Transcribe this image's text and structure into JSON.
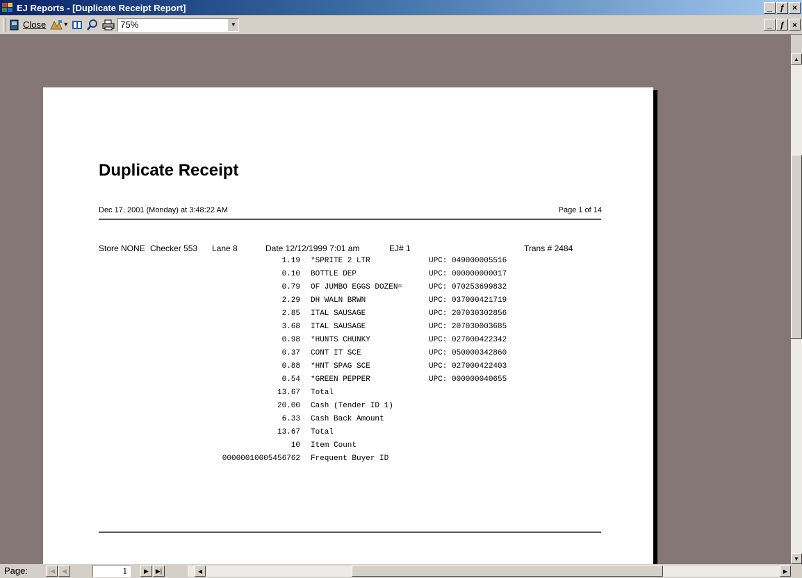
{
  "window": {
    "title": "EJ Reports - [Duplicate Receipt Report]",
    "minimize": "_",
    "restore": "ƒ",
    "close": "×"
  },
  "toolbar": {
    "close_label": "Close",
    "zoom_value": "75%",
    "icons": [
      "report-icon",
      "view-icon",
      "two-pages-icon",
      "zoom-icon",
      "print-icon"
    ]
  },
  "report": {
    "title": "Duplicate Receipt",
    "run_date": "Dec 17, 2001 (Monday) at 3:48:22 AM",
    "page_info": "Page 1 of 14",
    "store": "Store NONE",
    "checker": "Checker 553",
    "lane": "Lane  8",
    "date": "Date  12/12/1999 7:01 am",
    "ej": "EJ#  1",
    "trans": "Trans # 2484",
    "lines": [
      {
        "amount": "1.19",
        "desc": "*SPRITE 2 LTR",
        "upc": "UPC: 049000005516"
      },
      {
        "amount": "0.10",
        "desc": "BOTTLE DEP",
        "upc": "UPC: 000000000017"
      },
      {
        "amount": "0.79",
        "desc": "OF JUMBO EGGS DOZEN=",
        "upc": "UPC: 070253699832"
      },
      {
        "amount": "2.29",
        "desc": "DH WALN BRWN",
        "upc": "UPC: 037000421719"
      },
      {
        "amount": "2.85",
        "desc": "ITAL SAUSAGE",
        "upc": "UPC: 207030302856"
      },
      {
        "amount": "3.68",
        "desc": "ITAL SAUSAGE",
        "upc": "UPC: 207030003685"
      },
      {
        "amount": "0.98",
        "desc": "*HUNTS CHUNKY",
        "upc": "UPC: 027000422342"
      },
      {
        "amount": "0.37",
        "desc": "CONT IT SCE",
        "upc": "UPC: 050000342860"
      },
      {
        "amount": "0.88",
        "desc": "*HNT SPAG SCE",
        "upc": "UPC: 027000422403"
      },
      {
        "amount": "0.54",
        "desc": "*GREEN PEPPER",
        "upc": "UPC: 000000040655"
      },
      {
        "amount": "13.67",
        "desc": "Total",
        "upc": ""
      },
      {
        "amount": "20.00",
        "desc": "Cash (Tender ID 1)",
        "upc": ""
      },
      {
        "amount": "6.33",
        "desc": "Cash Back Amount",
        "upc": ""
      },
      {
        "amount": "13.67",
        "desc": "Total",
        "upc": ""
      },
      {
        "amount": "10",
        "desc": "Item Count",
        "upc": ""
      },
      {
        "amount": "00000010005456762",
        "desc": "Frequent Buyer ID",
        "upc": ""
      }
    ]
  },
  "navigation": {
    "page_label": "Page:",
    "current_page": "1"
  }
}
